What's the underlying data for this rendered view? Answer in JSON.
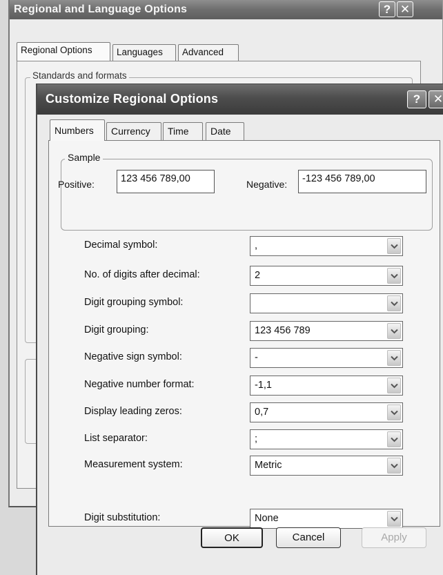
{
  "back_window": {
    "title": "Regional and Language Options",
    "help_glyph": "?",
    "close_glyph": "✕",
    "tabs": [
      {
        "label": "Regional Options",
        "active": true
      },
      {
        "label": "Languages",
        "active": false
      },
      {
        "label": "Advanced",
        "active": false
      }
    ],
    "group_label": "Standards and formats"
  },
  "front_window": {
    "title": "Customize Regional Options",
    "help_glyph": "?",
    "close_glyph": "✕",
    "tabs": [
      {
        "label": "Numbers",
        "active": true
      },
      {
        "label": "Currency",
        "active": false
      },
      {
        "label": "Time",
        "active": false
      },
      {
        "label": "Date",
        "active": false
      }
    ],
    "sample": {
      "group_label": "Sample",
      "positive_label": "Positive:",
      "positive_value": "123 456 789,00",
      "negative_label": "Negative:",
      "negative_value": "-123 456 789,00"
    },
    "settings": [
      {
        "label": "Decimal symbol:",
        "value": ","
      },
      {
        "label": "No. of digits after decimal:",
        "value": "2"
      },
      {
        "label": "Digit grouping symbol:",
        "value": ""
      },
      {
        "label": "Digit grouping:",
        "value": "123 456 789"
      },
      {
        "label": "Negative sign symbol:",
        "value": "-"
      },
      {
        "label": "Negative number format:",
        "value": "-1,1"
      },
      {
        "label": "Display leading zeros:",
        "value": "0,7"
      },
      {
        "label": "List separator:",
        "value": ";"
      },
      {
        "label": "Measurement system:",
        "value": "Metric"
      },
      {
        "label": "Digit substitution:",
        "value": "None"
      }
    ],
    "buttons": {
      "ok": "OK",
      "cancel": "Cancel",
      "apply": "Apply"
    }
  },
  "icons": {
    "dropdown": "chevron-down-icon",
    "help": "help-icon",
    "close": "close-icon"
  }
}
